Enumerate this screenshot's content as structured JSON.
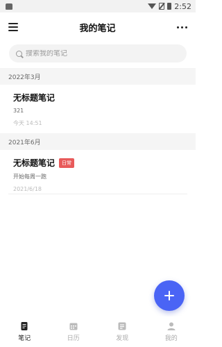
{
  "status_bar": {
    "time": "2:52"
  },
  "app_bar": {
    "title": "我的笔记"
  },
  "search": {
    "placeholder": "搜索我的笔记"
  },
  "sections": [
    {
      "header": "2022年3月",
      "notes": [
        {
          "title": "无标题笔记",
          "content": "321",
          "time": "今天  14:51"
        }
      ]
    },
    {
      "header": "2021年6月",
      "notes": [
        {
          "title": "无标题笔记",
          "tag": "日常",
          "content": "开始每周一跑",
          "time": "2021/6/18"
        }
      ]
    }
  ],
  "bottom_nav": [
    {
      "label": "笔记",
      "icon": "note-icon",
      "active": true
    },
    {
      "label": "日历",
      "icon": "calendar-icon",
      "active": false
    },
    {
      "label": "发现",
      "icon": "discover-icon",
      "active": false
    },
    {
      "label": "我的",
      "icon": "profile-icon",
      "active": false
    }
  ],
  "colors": {
    "accent": "#4a64f5",
    "tag_bg": "#e85a5a",
    "section_bg": "#f5f5f5"
  }
}
